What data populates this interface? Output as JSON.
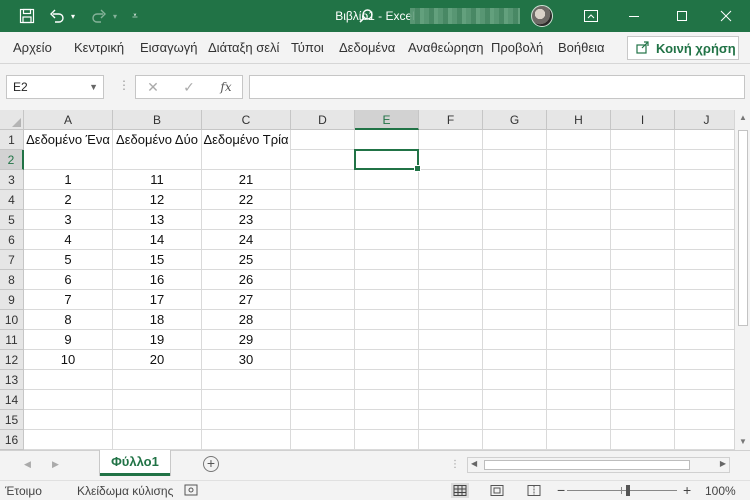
{
  "titlebar": {
    "doc_title": "Βιβλίο1  -  Excel",
    "icons": [
      "save-icon",
      "undo-icon",
      "redo-icon",
      "customize-qat-icon",
      "search-icon",
      "ribbon-display-icon",
      "minimize-icon",
      "maximize-icon",
      "close-icon"
    ]
  },
  "ribbon": {
    "tabs": [
      "Αρχείο",
      "Κεντρική",
      "Εισαγωγή",
      "Διάταξη σελί",
      "Τύποι",
      "Δεδομένα",
      "Αναθεώρηση",
      "Προβολή",
      "Βοήθεια"
    ],
    "share_label": "Κοινή χρήση"
  },
  "formula_bar": {
    "name_box": "E2",
    "fx_label": "fx",
    "formula": ""
  },
  "grid": {
    "columns": [
      "A",
      "B",
      "C",
      "D",
      "E",
      "F",
      "G",
      "H",
      "I",
      "J"
    ],
    "rows": [
      "1",
      "2",
      "3",
      "4",
      "5",
      "6",
      "7",
      "8",
      "9",
      "10",
      "11",
      "12",
      "13",
      "14",
      "15",
      "16"
    ],
    "selected_cell": "E2",
    "headers": [
      "Δεδομένο Ένα",
      "Δεδομένο Δύο",
      "Δεδομένο Τρία"
    ],
    "data": [
      [
        "1",
        "11",
        "21"
      ],
      [
        "2",
        "12",
        "22"
      ],
      [
        "3",
        "13",
        "23"
      ],
      [
        "4",
        "14",
        "24"
      ],
      [
        "5",
        "15",
        "25"
      ],
      [
        "6",
        "16",
        "26"
      ],
      [
        "7",
        "17",
        "27"
      ],
      [
        "8",
        "18",
        "28"
      ],
      [
        "9",
        "19",
        "29"
      ],
      [
        "10",
        "20",
        "30"
      ]
    ]
  },
  "sheets": {
    "active": "Φύλλο1"
  },
  "statusbar": {
    "ready": "Έτοιμο",
    "scroll_lock": "Κλείδωμα κύλισης",
    "zoom": "100%"
  },
  "colors": {
    "accent": "#217346",
    "titlebar": "#217346",
    "ribbon_bg": "#f3f3f3"
  }
}
